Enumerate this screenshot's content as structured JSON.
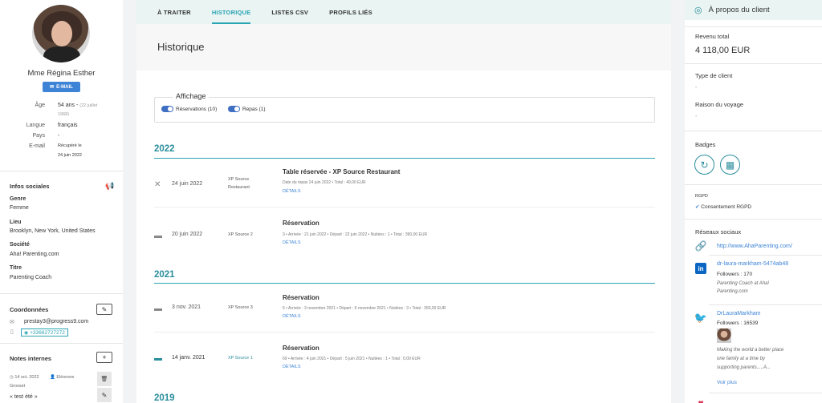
{
  "client": {
    "name": "Mme Régina Esther",
    "email_button": "E-MAIL",
    "age_label": "Âge",
    "age_value": "54 ans -",
    "age_birth_1": "(22 juillet",
    "age_birth_2": "1968)",
    "langue_label": "Langue",
    "langue_value": "français",
    "pays_label": "Pays",
    "pays_value": "-",
    "email_label": "E-mail",
    "email_value_1": "Récupéré le",
    "email_value_2": "24 juin 2022"
  },
  "infos_sociales": {
    "title": "Infos sociales",
    "genre_label": "Genre",
    "genre_value": "Femme",
    "lieu_label": "Lieu",
    "lieu_value": "Brooklyn, New York, United States",
    "societe_label": "Société",
    "societe_value": "Aha! Parenting.com",
    "titre_label": "Titre",
    "titre_value": "Parenting Coach"
  },
  "coordonnees": {
    "title": "Coordonnées",
    "email": "prestay3@progress9.com",
    "phone": "+33662727272"
  },
  "notes": {
    "title": "Notes internes",
    "date": "14 oct. 2022",
    "author_1": "Eléonore",
    "author_2": "Grosset",
    "text": "« test été »"
  },
  "tabs": [
    "À TRAITER",
    "HISTORIQUE",
    "LISTES CSV",
    "PROFILS LIÉS"
  ],
  "page_title": "Historique",
  "affichage": {
    "title": "Affichage",
    "toggle_1": "Réservations (10)",
    "toggle_2": "Repas (1)"
  },
  "history": {
    "year_2022": "2022",
    "year_2021": "2021",
    "year_2019": "2019",
    "entries": [
      {
        "date": "24 juin 2022",
        "source_1": "XP Source",
        "source_2": "Restaurant",
        "title": "Table réservée - XP Source Restaurant",
        "detail": "Date du repas 24 juin 2022   •   Total : 49,00 EUR",
        "link": "DÉTAILS"
      },
      {
        "date": "20 juin 2022",
        "source_1": "XP Source 2",
        "title": "Réservation",
        "detail": "3   •   Arrivée : 21 juin 2022   •   Départ : 22 juin 2022   •   Nuitées : 1   •   Total : 390,00 EUR",
        "link": "DÉTAILS"
      },
      {
        "date": "3 nov. 2021",
        "source_1": "XP Source 3",
        "title": "Réservation",
        "detail": "5   •   Arrivée : 3 novembre 2021   •   Départ : 6 novembre 2021   •   Nuitées : 3   •   Total : 350,00 EUR",
        "link": "DÉTAILS"
      },
      {
        "date": "14 janv. 2021",
        "source_1": "XP Source 1",
        "title": "Réservation",
        "detail": "69   •   Arrivée : 4 juin 2021   •   Départ : 5 juin 2021   •   Nuitées : 1   •   Total : 0,00 EUR",
        "link": "DÉTAILS"
      }
    ]
  },
  "about": {
    "header": "À propos du client",
    "revenu_label": "Revenu total",
    "revenu_value": "4 118,00 EUR",
    "type_label": "Type de client",
    "type_value": "-",
    "raison_label": "Raison du voyage",
    "raison_value": "-",
    "badges_label": "Badges",
    "rgpd_label": "RGPD",
    "rgpd_value": "Consentement RGPD",
    "reseaux_label": "Réseaux sociaux",
    "website": "http://www.AhaParenting.com/",
    "linkedin_handle": "dr-laura-markham-5474ab48",
    "linkedin_followers": "Followers : 170",
    "linkedin_bio_1": "Parenting Coach at Aha!",
    "linkedin_bio_2": "Parenting.com",
    "twitter_handle": "DrLauraMarkham",
    "twitter_followers": "Followers : 16539",
    "twitter_bio_1": "Making the world a better place",
    "twitter_bio_2": "one family at a time by",
    "twitter_bio_3": "supporting parents.....A...",
    "voir_plus": "Voir plus"
  },
  "colors": {
    "accent": "#2ba4b3",
    "primary_button": "#3e84d6",
    "linkedin": "#0a66c2",
    "twitter": "#1da1f2"
  }
}
